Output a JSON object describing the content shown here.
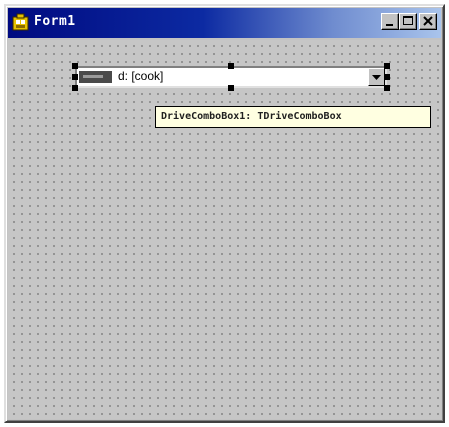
{
  "window": {
    "title": "Form1",
    "title_color": "#ffffff",
    "titlebar_gradient": [
      "#000a80",
      "#a9c4ec"
    ],
    "face_color": "#c3c3c3",
    "buttons": [
      "minimize-icon",
      "maximize-icon",
      "close-icon"
    ]
  },
  "combo": {
    "value": "d: [cook]",
    "icon": "drive-icon"
  },
  "tooltip": {
    "text": "DriveComboBox1: TDriveComboBox",
    "background": "#ffffe1"
  }
}
